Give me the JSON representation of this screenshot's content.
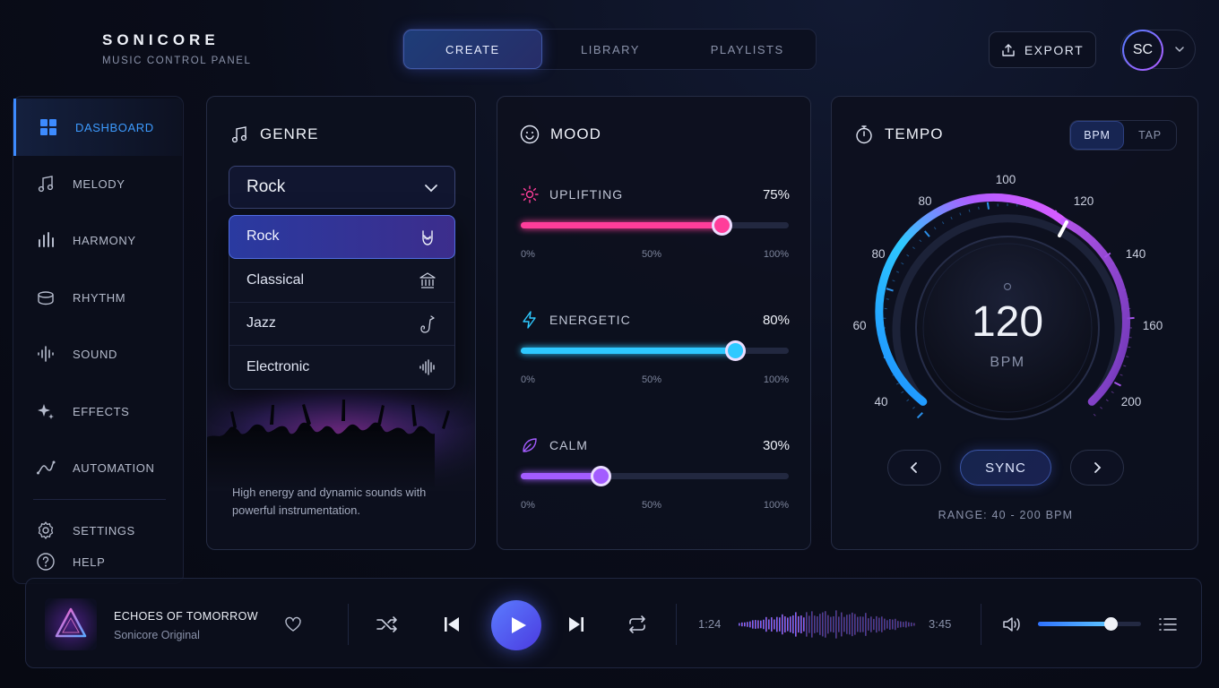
{
  "brand": {
    "name": "SONICORE",
    "subtitle": "MUSIC CONTROL PANEL"
  },
  "tabs": [
    {
      "label": "CREATE",
      "active": true
    },
    {
      "label": "LIBRARY"
    },
    {
      "label": "PLAYLISTS"
    }
  ],
  "header": {
    "export_label": "EXPORT",
    "user_initials": "SC"
  },
  "sidebar": {
    "items": [
      {
        "label": "DASHBOARD",
        "icon": "grid-icon",
        "active": true
      },
      {
        "label": "MELODY",
        "icon": "music-note-icon"
      },
      {
        "label": "HARMONY",
        "icon": "bars-icon"
      },
      {
        "label": "RHYTHM",
        "icon": "drum-icon"
      },
      {
        "label": "SOUND",
        "icon": "waveform-icon"
      },
      {
        "label": "EFFECTS",
        "icon": "sparkle-icon"
      },
      {
        "label": "AUTOMATION",
        "icon": "curve-icon"
      }
    ],
    "footer": [
      {
        "label": "SETTINGS",
        "icon": "gear-icon"
      },
      {
        "label": "HELP",
        "icon": "help-icon"
      }
    ]
  },
  "genre": {
    "title": "GENRE",
    "selected": "Rock",
    "options": [
      {
        "label": "Rock",
        "icon": "rock-hand-icon"
      },
      {
        "label": "Classical",
        "icon": "columns-icon"
      },
      {
        "label": "Jazz",
        "icon": "saxophone-icon"
      },
      {
        "label": "Electronic",
        "icon": "waveform-icon"
      }
    ],
    "description": "High energy and dynamic sounds with powerful instrumentation."
  },
  "mood": {
    "title": "MOOD",
    "items": [
      {
        "label": "UPLIFTING",
        "value_label": "75%",
        "value": 75,
        "color": "#ff3d9a",
        "icon": "sun-icon"
      },
      {
        "label": "ENERGETIC",
        "value_label": "80%",
        "value": 80,
        "color": "#2ec9ff",
        "icon": "lightning-icon"
      },
      {
        "label": "CALM",
        "value_label": "30%",
        "value": 30,
        "color": "#a35cff",
        "icon": "leaf-icon"
      }
    ],
    "scale": [
      "0%",
      "50%",
      "100%"
    ]
  },
  "tempo": {
    "title": "TEMPO",
    "modes": [
      {
        "label": "BPM",
        "active": true
      },
      {
        "label": "TAP"
      }
    ],
    "value": "120",
    "unit": "BPM",
    "ticks": [
      "40",
      "60",
      "80",
      "80",
      "100",
      "120",
      "140",
      "160",
      "200"
    ],
    "sync_label": "SYNC",
    "range_label": "RANGE: 40 - 200 BPM"
  },
  "player": {
    "title": "ECHOES OF TOMORROW",
    "artist": "Sonicore Original",
    "elapsed": "1:24",
    "duration": "3:45",
    "progress": 0.37,
    "volume": 0.7
  },
  "colors": {
    "accent": "#3d8bff",
    "purple": "#8b5cff",
    "pink": "#ff3d9a",
    "cyan": "#2ec9ff"
  }
}
